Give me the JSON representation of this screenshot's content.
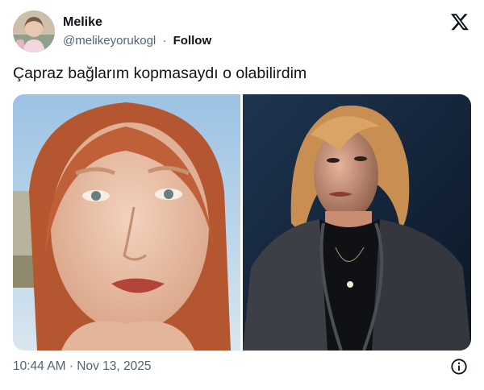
{
  "author": {
    "name": "Melike",
    "handle": "@melikeyorukogl",
    "separator": "·",
    "follow_label": "Follow"
  },
  "tweet": {
    "text": "Çapraz bağlarım kopmasaydı o olabilirdim"
  },
  "media": {
    "count": 2
  },
  "footer": {
    "timestamp": "10:44 AM · Nov 13, 2025"
  },
  "icons": {
    "logo": "x-logo-icon",
    "info": "info-icon"
  },
  "colors": {
    "text_primary": "#0f1419",
    "text_secondary": "#536471"
  }
}
